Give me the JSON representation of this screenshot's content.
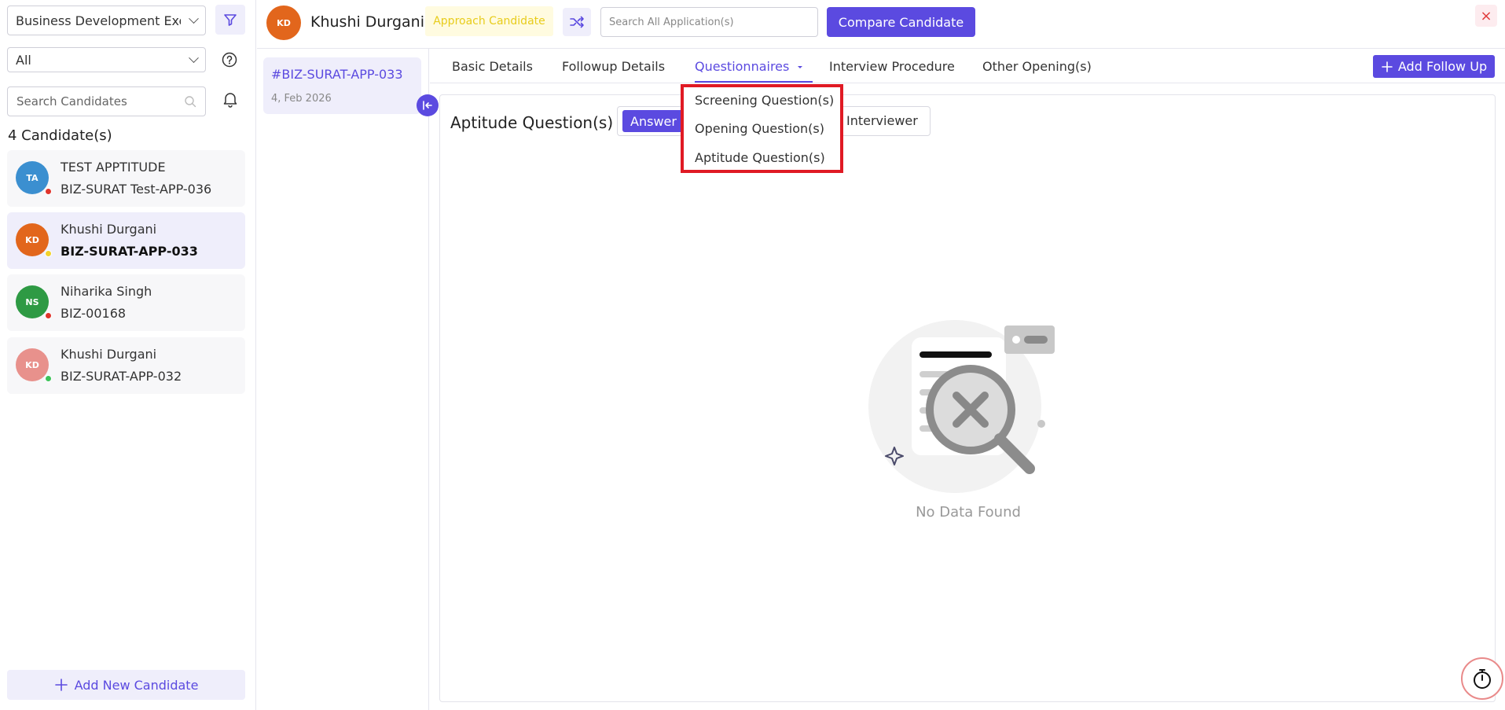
{
  "sidebar": {
    "position_filter": "Business Development Exec",
    "status_filter": "All",
    "search_placeholder": "Search Candidates",
    "count_label": "4 Candidate(s)",
    "candidates": [
      {
        "initials": "TA",
        "name": "TEST APPTITUDE",
        "code": "BIZ-SURAT Test-APP-036",
        "avatar_color": "#3b8fd0",
        "status_color": "#e0342c"
      },
      {
        "initials": "KD",
        "name": "Khushi Durgani",
        "code": "BIZ-SURAT-APP-033",
        "avatar_color": "#e2661c",
        "status_color": "#f2d22c"
      },
      {
        "initials": "NS",
        "name": "Niharika Singh",
        "code": "BIZ-00168",
        "avatar_color": "#2e9a44",
        "status_color": "#e0342c"
      },
      {
        "initials": "KD",
        "name": "Khushi Durgani",
        "code": "BIZ-SURAT-APP-032",
        "avatar_color": "#e8918c",
        "status_color": "#3cc35a"
      }
    ],
    "add_label": "Add New Candidate"
  },
  "header": {
    "initials": "KD",
    "candidate_name": "Khushi Durgani",
    "status_badge": "Approach Candidate",
    "search_placeholder": "Search All Application(s)",
    "compare_label": "Compare Candidate",
    "close_glyph": "×"
  },
  "application": {
    "id": "#BIZ-SURAT-APP-033",
    "date": "4, Feb 2026"
  },
  "tabs": {
    "basic": "Basic Details",
    "followup": "Followup Details",
    "questionnaires": "Questionnaires",
    "interview": "Interview Procedure",
    "other": "Other Opening(s)",
    "add_follow_up": "Add Follow Up"
  },
  "questionnaire_menu": {
    "items": [
      "Screening Question(s)",
      "Opening Question(s)",
      "Aptitude Question(s)"
    ]
  },
  "panel": {
    "title": "Aptitude Question(s)",
    "answer_label": "Answer",
    "interviewer_label": "Interviewer",
    "empty_text": "No Data Found"
  },
  "colors": {
    "accent": "#5b4ae0",
    "accent_light": "#efeefb",
    "highlight_border": "#e01a24"
  }
}
